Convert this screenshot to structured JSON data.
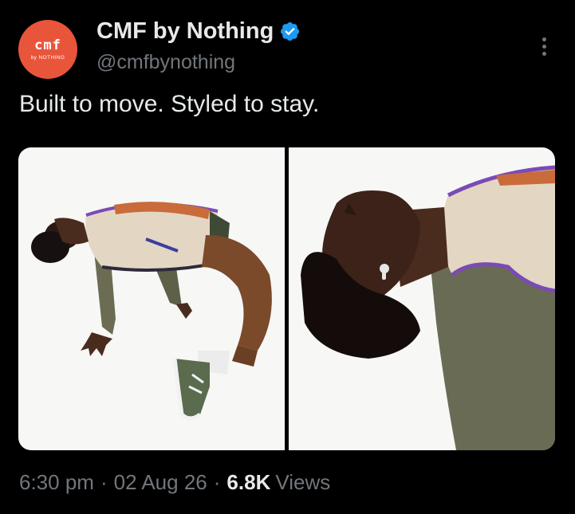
{
  "account": {
    "display_name": "CMF by Nothing",
    "handle": "@cmfbynothing",
    "avatar_logo_text": "cmf",
    "avatar_sub_text": "by NOTHING",
    "verified": true,
    "avatar_color": "#e9553a",
    "verified_color": "#1d9bf0"
  },
  "tweet": {
    "text": "Built to move. Styled to stay.",
    "media": [
      {
        "description_name": "photo-1"
      },
      {
        "description_name": "photo-2"
      }
    ]
  },
  "meta": {
    "time": "6:30 pm",
    "separator": "·",
    "date": "02 Aug 26",
    "views_count": "6.8K",
    "views_label": "Views"
  },
  "icons": {
    "verified": "verified-badge-icon",
    "more": "more-options-icon"
  }
}
